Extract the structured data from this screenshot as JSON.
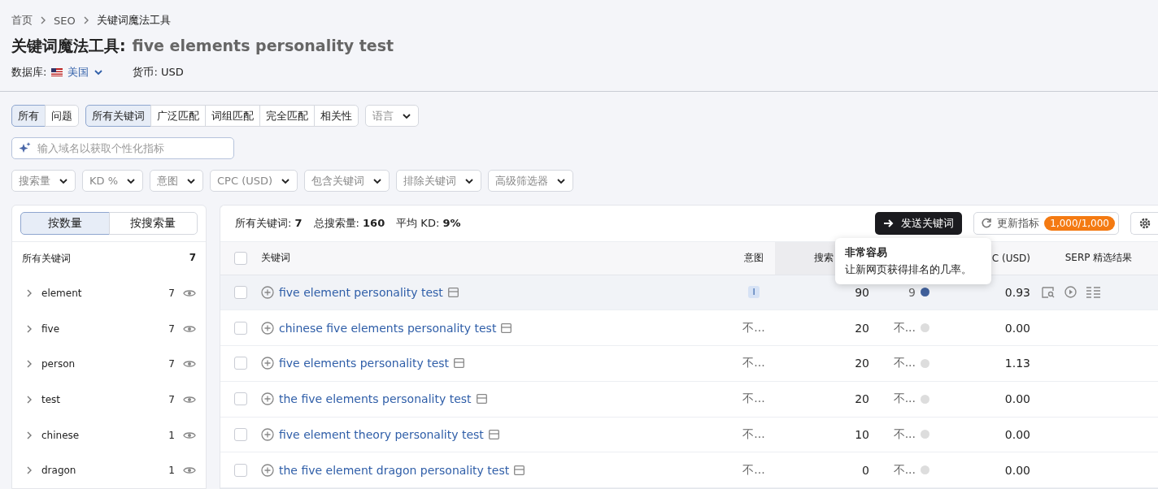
{
  "breadcrumb": [
    "首页",
    "SEO",
    "关键词魔法工具"
  ],
  "title": {
    "tool": "关键词魔法工具:",
    "query": "five elements personality test"
  },
  "database": {
    "label": "数据库:",
    "value": "美国",
    "currency": "货币: USD"
  },
  "type_tabs": [
    {
      "label": "所有",
      "selected": true
    },
    {
      "label": "问题",
      "selected": false
    }
  ],
  "match_tabs": [
    {
      "label": "所有关键词",
      "selected": true
    },
    {
      "label": "广泛匹配",
      "selected": false
    },
    {
      "label": "词组匹配",
      "selected": false
    },
    {
      "label": "完全匹配",
      "selected": false
    },
    {
      "label": "相关性",
      "selected": false
    }
  ],
  "language": {
    "placeholder": "语言"
  },
  "domain_input": {
    "placeholder": "输入域名以获取个性化指标"
  },
  "filters": [
    "搜索量",
    "KD %",
    "意图",
    "CPC (USD)",
    "包含关键词",
    "排除关键词",
    "高级筛选器"
  ],
  "group_tabs": [
    {
      "label": "按数量",
      "selected": true
    },
    {
      "label": "按搜索量",
      "selected": false
    }
  ],
  "groups_header": {
    "label": "所有关键词",
    "count": "7"
  },
  "groups": [
    {
      "name": "element",
      "count": "7"
    },
    {
      "name": "five",
      "count": "7"
    },
    {
      "name": "person",
      "count": "7"
    },
    {
      "name": "test",
      "count": "7"
    },
    {
      "name": "chinese",
      "count": "1"
    },
    {
      "name": "dragon",
      "count": "1"
    }
  ],
  "summary": [
    {
      "label": "所有关键词:",
      "value": "7"
    },
    {
      "label": "总搜索量:",
      "value": "160"
    },
    {
      "label": "平均 KD:",
      "value": "9%"
    }
  ],
  "actions": {
    "send": "发送关键词",
    "update": "更新指标",
    "quota": "1,000/1,000"
  },
  "columns": {
    "keyword": "关键词",
    "intent": "意图",
    "volume": "搜索",
    "cpc": "C (USD)",
    "serp": "SERP 精选结果"
  },
  "all_selected": false,
  "rows": [
    {
      "keyword": "five element personality test",
      "intent": {
        "kind": "badge",
        "text": "I"
      },
      "volume": "90",
      "kd": "9",
      "color": "#3f5f9a",
      "cpc": "0.93",
      "hovered": true,
      "selected": false
    },
    {
      "keyword": "chinese five elements personality test",
      "intent": {
        "kind": "text",
        "text": "不..."
      },
      "volume": "20",
      "kd": "不...",
      "color": "#dddddd",
      "cpc": "0.00",
      "hovered": false,
      "selected": false
    },
    {
      "keyword": "five elements personality test",
      "intent": {
        "kind": "text",
        "text": "不..."
      },
      "volume": "20",
      "kd": "不...",
      "color": "#dddddd",
      "cpc": "1.13",
      "hovered": false,
      "selected": false
    },
    {
      "keyword": "the five elements personality test",
      "intent": {
        "kind": "text",
        "text": "不..."
      },
      "volume": "20",
      "kd": "不...",
      "color": "#dddddd",
      "cpc": "0.00",
      "hovered": false,
      "selected": false
    },
    {
      "keyword": "five element theory personality test",
      "intent": {
        "kind": "text",
        "text": "不..."
      },
      "volume": "10",
      "kd": "不...",
      "color": "#dddddd",
      "cpc": "0.00",
      "hovered": false,
      "selected": false
    },
    {
      "keyword": "the five element dragon personality test",
      "intent": {
        "kind": "text",
        "text": "不..."
      },
      "volume": "0",
      "kd": "不...",
      "color": "#dddddd",
      "cpc": "0.00",
      "hovered": false,
      "selected": false
    }
  ],
  "tooltip": {
    "title": "非常容易",
    "text": "让新网页获得排名的几率。"
  }
}
